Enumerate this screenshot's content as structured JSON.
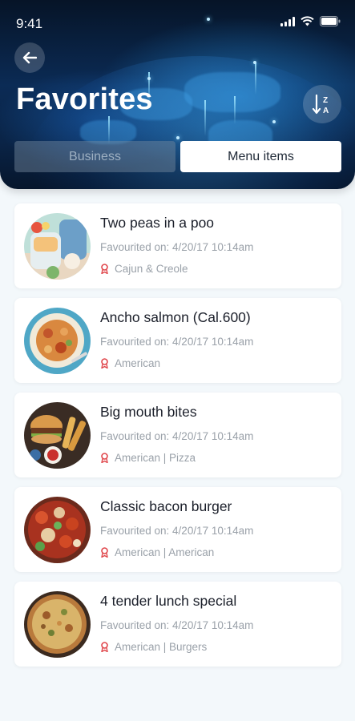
{
  "status_bar": {
    "time": "9:41"
  },
  "header": {
    "title": "Favorites",
    "tabs": [
      {
        "label": "Business",
        "active": false
      },
      {
        "label": "Menu items",
        "active": true
      }
    ]
  },
  "favorites": [
    {
      "title": "Two peas in a poo",
      "date": "Favourited on: 4/20/17 10:14am",
      "category": "Cajun & Creole",
      "image": "drinks-and-cups"
    },
    {
      "title": "Ancho salmon (Cal.600)",
      "date": "Favourited on: 4/20/17 10:14am",
      "category": "American",
      "image": "pasta-plate"
    },
    {
      "title": "Big mouth bites",
      "date": "Favourited on: 4/20/17 10:14am",
      "category": "American | Pizza",
      "image": "burger-and-fries"
    },
    {
      "title": "Classic bacon burger",
      "date": "Favourited on: 4/20/17 10:14am",
      "category": "American | American",
      "image": "tomato-dish"
    },
    {
      "title": "4 tender lunch special",
      "date": "Favourited on: 4/20/17 10:14am",
      "category": "American | Burgers",
      "image": "pizza"
    }
  ],
  "colors": {
    "accent_red": "#e0474c",
    "header_dark": "#0b2b55"
  }
}
